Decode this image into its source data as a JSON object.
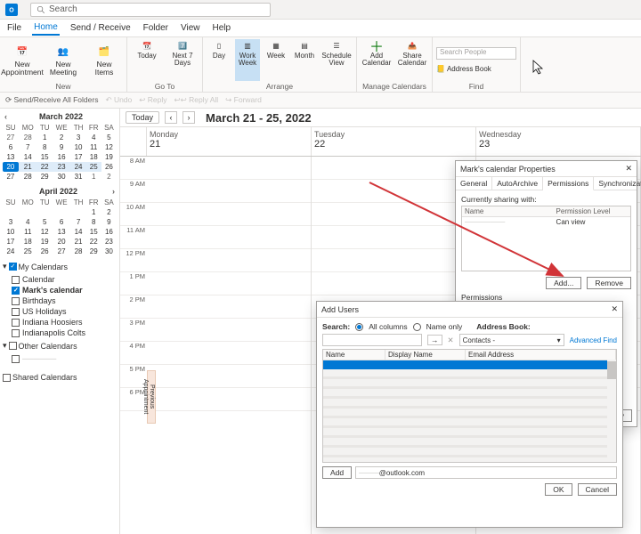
{
  "titlebar": {
    "search_placeholder": "Search"
  },
  "tabs": {
    "file": "File",
    "home": "Home",
    "sendrecv": "Send / Receive",
    "folder": "Folder",
    "view": "View",
    "help": "Help"
  },
  "ribbon": {
    "new_appointment": "New\nAppointment",
    "new_meeting": "New\nMeeting",
    "new_items": "New\nItems",
    "new_group": "New",
    "today": "Today",
    "next7": "Next 7\nDays",
    "goto_group": "Go To",
    "day": "Day",
    "workweek": "Work\nWeek",
    "week": "Week",
    "month": "Month",
    "schedview": "Schedule\nView",
    "arrange_group": "Arrange",
    "addcal": "Add\nCalendar",
    "sharecal": "Share\nCalendar",
    "manage_group": "Manage Calendars",
    "search_people": "Search People",
    "address_book": "Address Book",
    "find_group": "Find"
  },
  "quicktb": {
    "sendrecv": "Send/Receive All Folders",
    "undo": "Undo",
    "reply": "Reply",
    "replyall": "Reply All",
    "forward": "Forward"
  },
  "minical": {
    "month1": "March 2022",
    "month2": "April 2022",
    "dow": [
      "SU",
      "MO",
      "TU",
      "WE",
      "TH",
      "FR",
      "SA"
    ]
  },
  "calendars": {
    "group1": "My Calendars",
    "items1": [
      "Calendar",
      "Mark's calendar",
      "Birthdays",
      "US Holidays",
      "Indiana Hoosiers",
      "Indianapolis Colts"
    ],
    "group2": "Other Calendars",
    "group3": "Shared Calendars"
  },
  "view": {
    "today_btn": "Today",
    "range": "March 21 - 25, 2022",
    "days": [
      "Monday",
      "Tuesday",
      "Wednesday"
    ],
    "nums": [
      "21",
      "22",
      "23"
    ],
    "hours": [
      "8 AM",
      "9 AM",
      "10 AM",
      "11 AM",
      "12 PM",
      "1 PM",
      "2 PM",
      "3 PM",
      "4 PM",
      "5 PM",
      "6 PM"
    ],
    "prev_apt": "Previous Appointment"
  },
  "props": {
    "title": "Mark's calendar Properties",
    "tabs": [
      "General",
      "AutoArchive",
      "Permissions",
      "Synchronization"
    ],
    "sharing_label": "Currently sharing with:",
    "col_name": "Name",
    "col_perm": "Permission Level",
    "row_perm": "Can view",
    "perm_label": "Permissions",
    "add": "Add...",
    "remove": "Remove",
    "apply": "Apply"
  },
  "addusers": {
    "title": "Add Users",
    "search": "Search:",
    "allcols": "All columns",
    "nameonly": "Name only",
    "ab_label": "Address Book:",
    "ab_value": "Contacts -",
    "advfind": "Advanced Find",
    "col_name": "Name",
    "col_display": "Display Name",
    "col_email": "Email Address",
    "add": "Add",
    "email": "@outlook.com",
    "ok": "OK",
    "cancel": "Cancel"
  }
}
